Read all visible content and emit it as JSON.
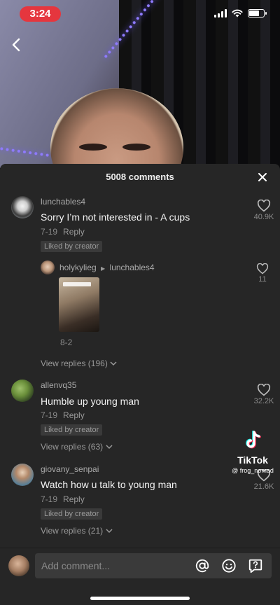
{
  "status_bar": {
    "time": "3:24",
    "battery_level": 0.7
  },
  "comments_panel": {
    "title": "5008 comments",
    "input_placeholder": "Add comment..."
  },
  "comments": [
    {
      "username": "lunchables4",
      "text": "Sorry I’m not interested in - A cups",
      "date": "7-19",
      "reply_label": "Reply",
      "badge": "Liked by creator",
      "likes": "40.9K",
      "view_replies": "View replies (196)"
    },
    {
      "username": "allenvq35",
      "text": "Humble up young man",
      "date": "7-19",
      "reply_label": "Reply",
      "badge": "Liked by creator",
      "likes": "32.2K",
      "view_replies": "View replies (63)"
    },
    {
      "username": "giovany_senpai",
      "text": "Watch how u talk to young man",
      "date": "7-19",
      "reply_label": "Reply",
      "badge": "Liked by creator",
      "likes": "21.6K",
      "view_replies": "View replies (21)"
    }
  ],
  "reply": {
    "username": "holykylieg",
    "reply_to": "lunchables4",
    "date": "8-2",
    "likes": "11"
  },
  "watermark": {
    "brand": "TikTok",
    "handle": "@ frog_nomad"
  },
  "colors": {
    "sheet_bg": "#262626",
    "time_pill": "#e5363e",
    "accent_pink": "#fe2c55",
    "accent_cyan": "#25f4ee"
  }
}
